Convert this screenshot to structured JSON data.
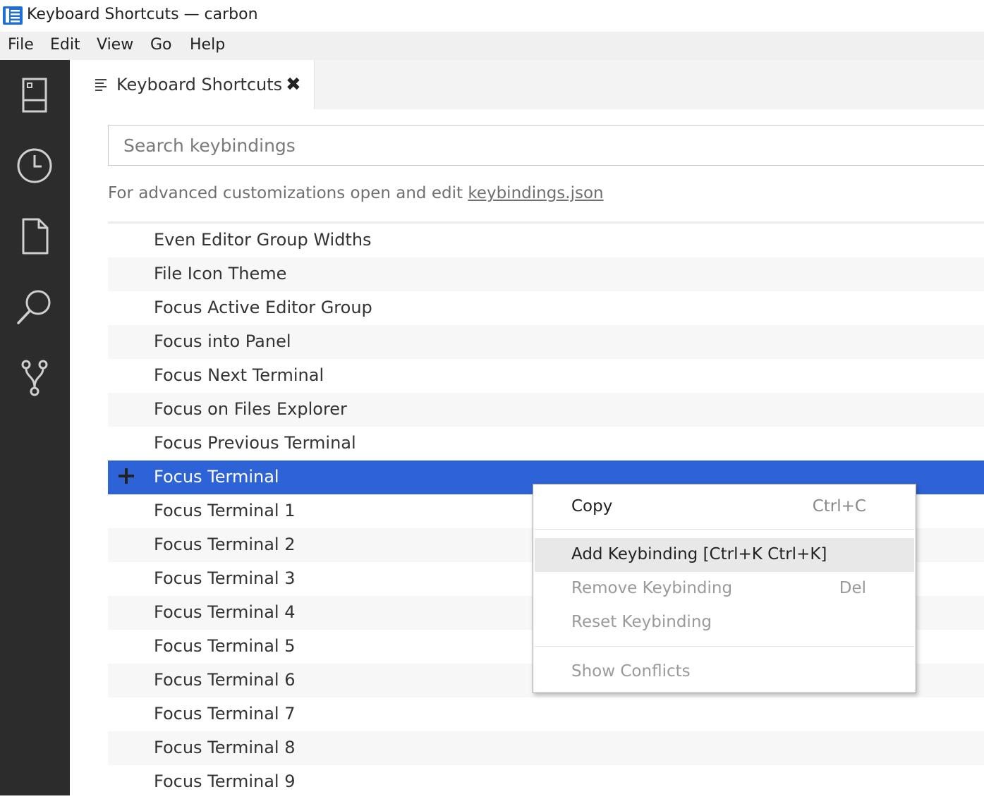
{
  "window": {
    "title": "Keyboard Shortcuts — carbon"
  },
  "menubar": {
    "items": [
      "File",
      "Edit",
      "View",
      "Go",
      "Help"
    ]
  },
  "activitybar": {
    "icons": [
      "explorer-panel-icon",
      "clock-icon",
      "file-icon",
      "search-icon",
      "source-control-icon"
    ]
  },
  "tab": {
    "label": "Keyboard Shortcuts",
    "close": "✖"
  },
  "search": {
    "placeholder": "Search keybindings"
  },
  "hint": {
    "text": "For advanced customizations open and edit ",
    "link": "keybindings.json"
  },
  "commands": [
    "Even Editor Group Widths",
    "File Icon Theme",
    "Focus Active Editor Group",
    "Focus into Panel",
    "Focus Next Terminal",
    "Focus on Files Explorer",
    "Focus Previous Terminal",
    "Focus Terminal",
    "Focus Terminal 1",
    "Focus Terminal 2",
    "Focus Terminal 3",
    "Focus Terminal 4",
    "Focus Terminal 5",
    "Focus Terminal 6",
    "Focus Terminal 7",
    "Focus Terminal 8",
    "Focus Terminal 9"
  ],
  "selected_command": "Focus Terminal",
  "context_menu": {
    "copy": {
      "label": "Copy",
      "shortcut": "Ctrl+C"
    },
    "add": {
      "label": "Add Keybinding [Ctrl+K Ctrl+K]"
    },
    "remove": {
      "label": "Remove Keybinding",
      "shortcut": "Del"
    },
    "reset": {
      "label": "Reset Keybinding"
    },
    "conflicts": {
      "label": "Show Conflicts"
    }
  },
  "colors": {
    "selection": "#2d63d6",
    "activitybar": "#2c2c2c",
    "icon_blue": "#1e6fd9"
  }
}
